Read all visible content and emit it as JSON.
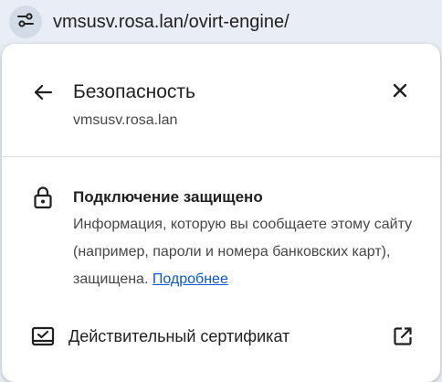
{
  "address_bar": {
    "url": "vmsusv.rosa.lan/ovirt-engine/",
    "site_info_icon": "tune-icon"
  },
  "popup": {
    "back_icon": "arrow-left-icon",
    "title": "Безопасность",
    "subtitle": "vmsusv.rosa.lan",
    "close_icon": "close-icon",
    "security": {
      "icon": "lock-icon",
      "heading": "Подключение защищено",
      "description": "Информация, которую вы сообщаете этому сайту (например, пароли и номера банковских карт), защищена.",
      "link_label": "Подробнее"
    },
    "certificate": {
      "icon": "certificate-icon",
      "label": "Действительный сертификат",
      "external_icon": "open-external-icon"
    }
  },
  "colors": {
    "link": "#0b57d0",
    "text_primary": "#1f1f1f",
    "text_secondary": "#474747",
    "toolbar_bg": "#e9eef6"
  }
}
